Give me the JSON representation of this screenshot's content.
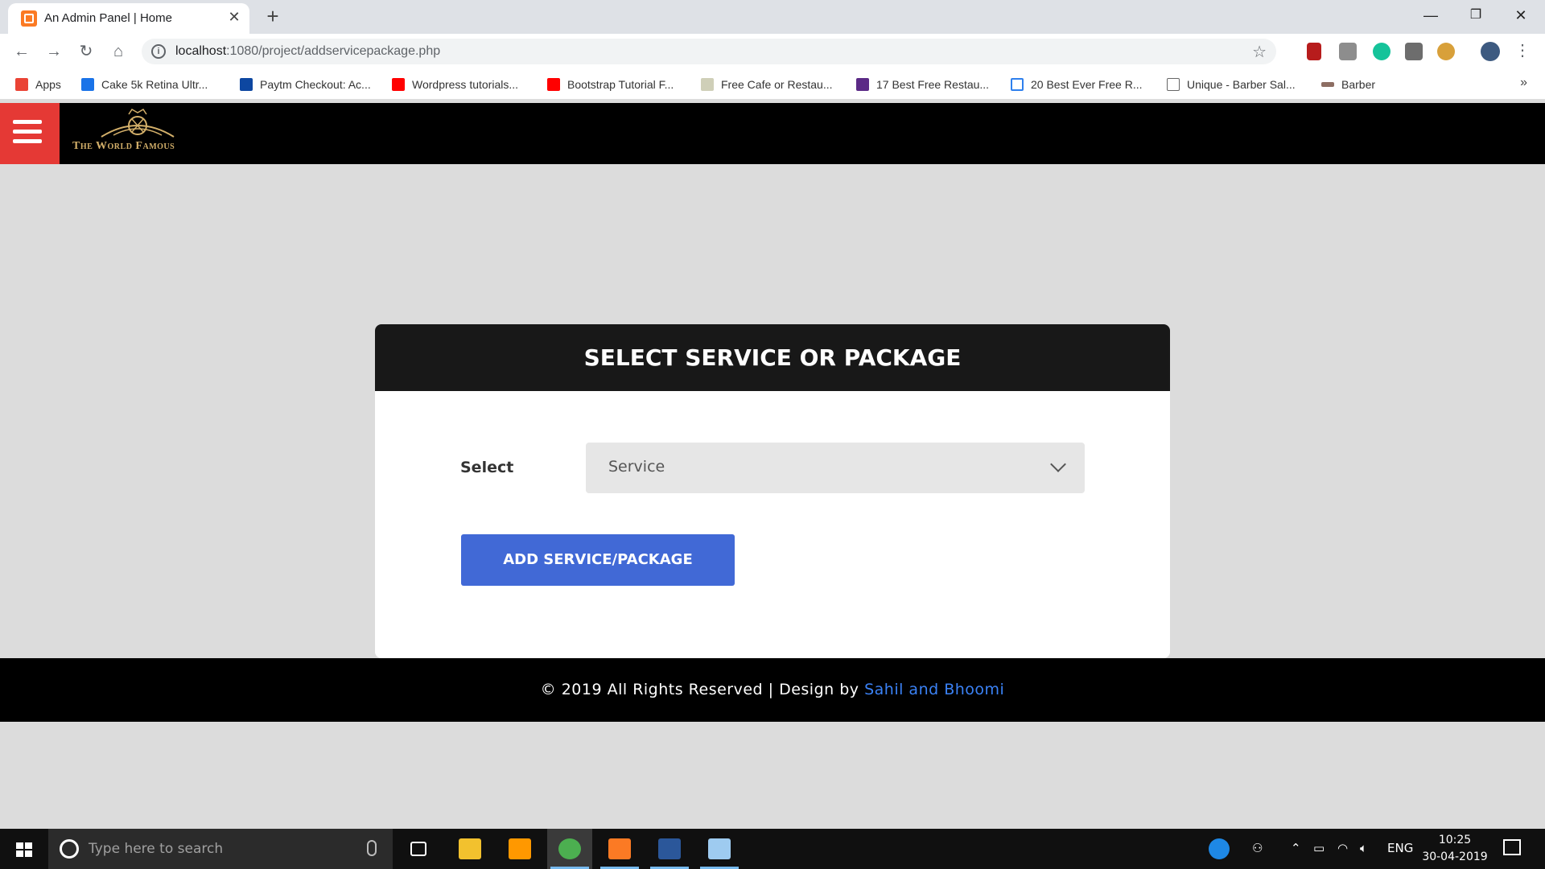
{
  "browser": {
    "tab_title": "An Admin Panel | Home",
    "tab_close": "✕",
    "new_tab": "+",
    "url_host": "localhost",
    "url_path": ":1080/project/addservicepackage.php",
    "win_minimize": "—",
    "win_restore": "❐",
    "win_close": "✕",
    "bookmarks_more": "»",
    "bookmarks": [
      {
        "label": "Apps",
        "color": "#ea4335"
      },
      {
        "label": "Cake 5k Retina Ultr...",
        "color": "#1a73e8"
      },
      {
        "label": "Paytm Checkout: Ac...",
        "color": "#0d47a1"
      },
      {
        "label": "Wordpress tutorials...",
        "color": "#ff0000"
      },
      {
        "label": "Bootstrap Tutorial F...",
        "color": "#ff0000"
      },
      {
        "label": "Free Cafe or Restau...",
        "color": "#cfcfb8"
      },
      {
        "label": "17 Best Free Restau...",
        "color": "#5b2a86"
      },
      {
        "label": "20 Best Ever Free R...",
        "color": "#2f80ed"
      },
      {
        "label": "Unique - Barber Sal...",
        "color": "#ffffff"
      },
      {
        "label": "Barber",
        "color": "#8d6e63"
      }
    ]
  },
  "site": {
    "logo_text": "The World Famous",
    "card_title": "SELECT SERVICE OR PACKAGE",
    "select_label": "Select",
    "select_value": "Service",
    "add_button": "ADD SERVICE/PACKAGE",
    "footer_text": "© 2019 All Rights Reserved | Design by ",
    "footer_link": "Sahil and Bhoomi"
  },
  "taskbar": {
    "search_placeholder": "Type here to search",
    "lang": "ENG",
    "time": "10:25",
    "date": "30-04-2019"
  },
  "colors": {
    "accent_red": "#e53935",
    "button_blue": "#4169d6",
    "link_blue": "#3b82f6"
  }
}
